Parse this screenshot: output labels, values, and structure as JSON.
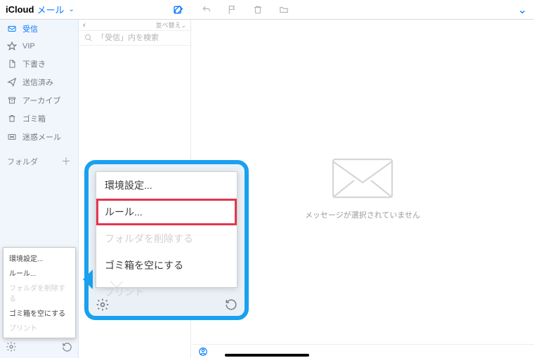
{
  "header": {
    "brand": "iCloud",
    "mail": "メール",
    "chev": "⌄"
  },
  "sidebar": {
    "items": [
      {
        "label": "受信",
        "icon": "inbox-icon",
        "selected": true
      },
      {
        "label": "VIP",
        "icon": "star-icon"
      },
      {
        "label": "下書き",
        "icon": "draft-icon"
      },
      {
        "label": "送信済み",
        "icon": "sent-icon"
      },
      {
        "label": "アーカイブ",
        "icon": "archive-icon"
      },
      {
        "label": "ゴミ箱",
        "icon": "trash-icon"
      },
      {
        "label": "迷惑メール",
        "icon": "junk-icon"
      }
    ],
    "section_label": "フォルダ"
  },
  "list": {
    "sort_label": "並べ替え",
    "chev": "⌄",
    "search_placeholder": "「受信」内を検索"
  },
  "preview": {
    "empty_message": "メッセージが選択されていません"
  },
  "menu": {
    "items": [
      {
        "label": "環境設定...",
        "disabled": false,
        "highlight": false
      },
      {
        "label": "ルール...",
        "disabled": false,
        "highlight": true
      },
      {
        "label": "フォルダを削除する",
        "disabled": true,
        "highlight": false
      },
      {
        "label": "ゴミ箱を空にする",
        "disabled": false,
        "highlight": false
      },
      {
        "label": "プリント",
        "disabled": true,
        "highlight": false
      }
    ]
  },
  "colors": {
    "accent": "#0a7aff",
    "callout": "#1aa0ef",
    "highlight": "#e6354f"
  }
}
